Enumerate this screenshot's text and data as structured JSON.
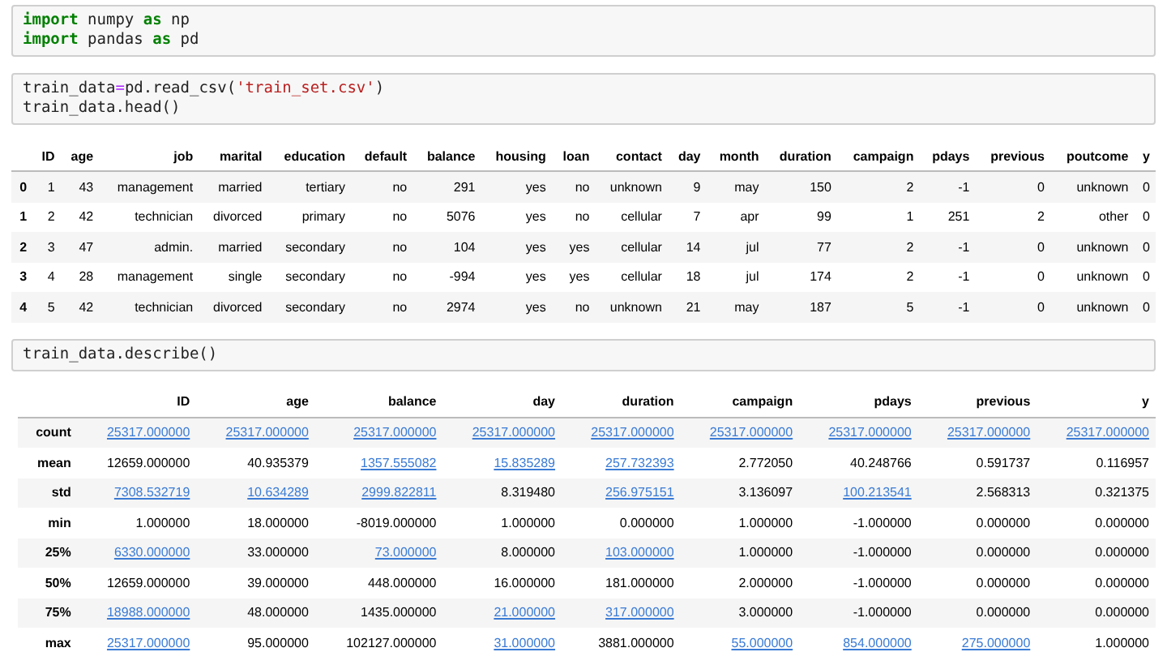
{
  "cells": [
    {
      "kind": "code",
      "lines": [
        [
          {
            "kind": "keyword",
            "text": "import"
          },
          {
            "kind": "plain",
            "text": " numpy "
          },
          {
            "kind": "keyword",
            "text": "as"
          },
          {
            "kind": "plain",
            "text": " np"
          }
        ],
        [
          {
            "kind": "keyword",
            "text": "import"
          },
          {
            "kind": "plain",
            "text": " pandas "
          },
          {
            "kind": "keyword",
            "text": "as"
          },
          {
            "kind": "plain",
            "text": " pd"
          }
        ]
      ]
    },
    {
      "kind": "code",
      "lines": [
        [
          {
            "kind": "plain",
            "text": "train_data"
          },
          {
            "kind": "operator",
            "text": "="
          },
          {
            "kind": "plain",
            "text": "pd.read_csv("
          },
          {
            "kind": "string",
            "text": "'train_set.csv'"
          },
          {
            "kind": "plain",
            "text": ")"
          }
        ],
        [
          {
            "kind": "plain",
            "text": "train_data.head()"
          }
        ]
      ]
    },
    {
      "kind": "table",
      "columns": [
        "ID",
        "age",
        "job",
        "marital",
        "education",
        "default",
        "balance",
        "housing",
        "loan",
        "contact",
        "day",
        "month",
        "duration",
        "campaign",
        "pdays",
        "previous",
        "poutcome",
        "y"
      ],
      "rows": [
        {
          "index": "0",
          "cells": [
            {
              "text": "1"
            },
            {
              "text": "43"
            },
            {
              "text": "management"
            },
            {
              "text": "married"
            },
            {
              "text": "tertiary"
            },
            {
              "text": "no"
            },
            {
              "text": "291"
            },
            {
              "text": "yes"
            },
            {
              "text": "no"
            },
            {
              "text": "unknown"
            },
            {
              "text": "9"
            },
            {
              "text": "may"
            },
            {
              "text": "150"
            },
            {
              "text": "2"
            },
            {
              "text": "-1"
            },
            {
              "text": "0"
            },
            {
              "text": "unknown"
            },
            {
              "text": "0"
            }
          ]
        },
        {
          "index": "1",
          "cells": [
            {
              "text": "2"
            },
            {
              "text": "42"
            },
            {
              "text": "technician"
            },
            {
              "text": "divorced"
            },
            {
              "text": "primary"
            },
            {
              "text": "no"
            },
            {
              "text": "5076"
            },
            {
              "text": "yes"
            },
            {
              "text": "no"
            },
            {
              "text": "cellular"
            },
            {
              "text": "7"
            },
            {
              "text": "apr"
            },
            {
              "text": "99"
            },
            {
              "text": "1"
            },
            {
              "text": "251"
            },
            {
              "text": "2"
            },
            {
              "text": "other"
            },
            {
              "text": "0"
            }
          ]
        },
        {
          "index": "2",
          "cells": [
            {
              "text": "3"
            },
            {
              "text": "47"
            },
            {
              "text": "admin."
            },
            {
              "text": "married"
            },
            {
              "text": "secondary"
            },
            {
              "text": "no"
            },
            {
              "text": "104"
            },
            {
              "text": "yes"
            },
            {
              "text": "yes"
            },
            {
              "text": "cellular"
            },
            {
              "text": "14"
            },
            {
              "text": "jul"
            },
            {
              "text": "77"
            },
            {
              "text": "2"
            },
            {
              "text": "-1"
            },
            {
              "text": "0"
            },
            {
              "text": "unknown"
            },
            {
              "text": "0"
            }
          ]
        },
        {
          "index": "3",
          "cells": [
            {
              "text": "4"
            },
            {
              "text": "28"
            },
            {
              "text": "management"
            },
            {
              "text": "single"
            },
            {
              "text": "secondary"
            },
            {
              "text": "no"
            },
            {
              "text": "-994"
            },
            {
              "text": "yes"
            },
            {
              "text": "yes"
            },
            {
              "text": "cellular"
            },
            {
              "text": "18"
            },
            {
              "text": "jul"
            },
            {
              "text": "174"
            },
            {
              "text": "2"
            },
            {
              "text": "-1"
            },
            {
              "text": "0"
            },
            {
              "text": "unknown"
            },
            {
              "text": "0"
            }
          ]
        },
        {
          "index": "4",
          "cells": [
            {
              "text": "5"
            },
            {
              "text": "42"
            },
            {
              "text": "technician"
            },
            {
              "text": "divorced"
            },
            {
              "text": "secondary"
            },
            {
              "text": "no"
            },
            {
              "text": "2974"
            },
            {
              "text": "yes"
            },
            {
              "text": "no"
            },
            {
              "text": "unknown"
            },
            {
              "text": "21"
            },
            {
              "text": "may"
            },
            {
              "text": "187"
            },
            {
              "text": "5"
            },
            {
              "text": "-1"
            },
            {
              "text": "0"
            },
            {
              "text": "unknown"
            },
            {
              "text": "0"
            }
          ]
        }
      ]
    },
    {
      "kind": "code",
      "lines": [
        [
          {
            "kind": "plain",
            "text": "train_data.describe()"
          }
        ]
      ]
    },
    {
      "kind": "table",
      "columns": [
        "ID",
        "age",
        "balance",
        "day",
        "duration",
        "campaign",
        "pdays",
        "previous",
        "y"
      ],
      "rows": [
        {
          "index": "count",
          "cells": [
            {
              "text": "25317.000000",
              "link": true
            },
            {
              "text": "25317.000000",
              "link": true
            },
            {
              "text": "25317.000000",
              "link": true
            },
            {
              "text": "25317.000000",
              "link": true
            },
            {
              "text": "25317.000000",
              "link": true
            },
            {
              "text": "25317.000000",
              "link": true
            },
            {
              "text": "25317.000000",
              "link": true
            },
            {
              "text": "25317.000000",
              "link": true
            },
            {
              "text": "25317.000000",
              "link": true
            }
          ]
        },
        {
          "index": "mean",
          "cells": [
            {
              "text": "12659.000000",
              "link": false
            },
            {
              "text": "40.935379",
              "link": false
            },
            {
              "text": "1357.555082",
              "link": true
            },
            {
              "text": "15.835289",
              "link": true
            },
            {
              "text": "257.732393",
              "link": true
            },
            {
              "text": "2.772050",
              "link": false
            },
            {
              "text": "40.248766",
              "link": false
            },
            {
              "text": "0.591737",
              "link": false
            },
            {
              "text": "0.116957",
              "link": false
            }
          ]
        },
        {
          "index": "std",
          "cells": [
            {
              "text": "7308.532719",
              "link": true
            },
            {
              "text": "10.634289",
              "link": true
            },
            {
              "text": "2999.822811",
              "link": true
            },
            {
              "text": "8.319480",
              "link": false
            },
            {
              "text": "256.975151",
              "link": true
            },
            {
              "text": "3.136097",
              "link": false
            },
            {
              "text": "100.213541",
              "link": true
            },
            {
              "text": "2.568313",
              "link": false
            },
            {
              "text": "0.321375",
              "link": false
            }
          ]
        },
        {
          "index": "min",
          "cells": [
            {
              "text": "1.000000",
              "link": false
            },
            {
              "text": "18.000000",
              "link": false
            },
            {
              "text": "-8019.000000",
              "link": false
            },
            {
              "text": "1.000000",
              "link": false
            },
            {
              "text": "0.000000",
              "link": false
            },
            {
              "text": "1.000000",
              "link": false
            },
            {
              "text": "-1.000000",
              "link": false
            },
            {
              "text": "0.000000",
              "link": false
            },
            {
              "text": "0.000000",
              "link": false
            }
          ]
        },
        {
          "index": "25%",
          "cells": [
            {
              "text": "6330.000000",
              "link": true
            },
            {
              "text": "33.000000",
              "link": false
            },
            {
              "text": "73.000000",
              "link": true
            },
            {
              "text": "8.000000",
              "link": false
            },
            {
              "text": "103.000000",
              "link": true
            },
            {
              "text": "1.000000",
              "link": false
            },
            {
              "text": "-1.000000",
              "link": false
            },
            {
              "text": "0.000000",
              "link": false
            },
            {
              "text": "0.000000",
              "link": false
            }
          ]
        },
        {
          "index": "50%",
          "cells": [
            {
              "text": "12659.000000",
              "link": false
            },
            {
              "text": "39.000000",
              "link": false
            },
            {
              "text": "448.000000",
              "link": false
            },
            {
              "text": "16.000000",
              "link": false
            },
            {
              "text": "181.000000",
              "link": false
            },
            {
              "text": "2.000000",
              "link": false
            },
            {
              "text": "-1.000000",
              "link": false
            },
            {
              "text": "0.000000",
              "link": false
            },
            {
              "text": "0.000000",
              "link": false
            }
          ]
        },
        {
          "index": "75%",
          "cells": [
            {
              "text": "18988.000000",
              "link": true
            },
            {
              "text": "48.000000",
              "link": false
            },
            {
              "text": "1435.000000",
              "link": false
            },
            {
              "text": "21.000000",
              "link": true
            },
            {
              "text": "317.000000",
              "link": true
            },
            {
              "text": "3.000000",
              "link": false
            },
            {
              "text": "-1.000000",
              "link": false
            },
            {
              "text": "0.000000",
              "link": false
            },
            {
              "text": "0.000000",
              "link": false
            }
          ]
        },
        {
          "index": "max",
          "cells": [
            {
              "text": "25317.000000",
              "link": true
            },
            {
              "text": "95.000000",
              "link": false
            },
            {
              "text": "102127.000000",
              "link": false
            },
            {
              "text": "31.000000",
              "link": true
            },
            {
              "text": "3881.000000",
              "link": false
            },
            {
              "text": "55.000000",
              "link": true
            },
            {
              "text": "854.000000",
              "link": true
            },
            {
              "text": "275.000000",
              "link": true
            },
            {
              "text": "1.000000",
              "link": false
            }
          ]
        }
      ]
    }
  ]
}
